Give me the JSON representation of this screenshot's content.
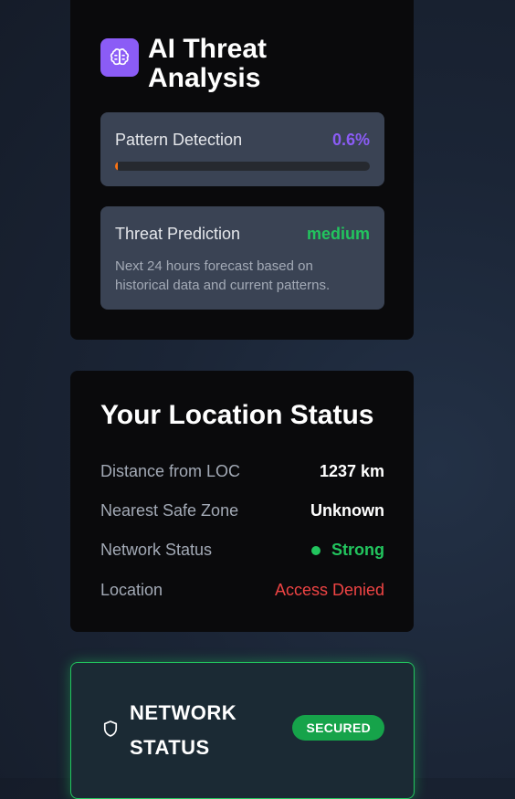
{
  "ai_threat": {
    "title": "AI Threat Analysis",
    "icon": "brain-icon",
    "accent_color": "#8b5cf6",
    "pattern_detection": {
      "label": "Pattern Detection",
      "value": "0.6%",
      "progress_fraction": 0.006
    },
    "threat_prediction": {
      "label": "Threat Prediction",
      "value": "medium",
      "description": "Next 24 hours forecast based on historical data and current patterns."
    }
  },
  "location_status": {
    "title": "Your Location Status",
    "rows": [
      {
        "label": "Distance from LOC",
        "value": "1237 km"
      },
      {
        "label": "Nearest Safe Zone",
        "value": "Unknown"
      },
      {
        "label": "Network Status",
        "value": "Strong",
        "status_color": "#22c55e"
      },
      {
        "label": "Location",
        "value": "Access Denied",
        "status_color": "#ef4444"
      }
    ]
  },
  "network_status": {
    "title": "NETWORK STATUS",
    "icon": "shield-icon",
    "badge": "SECURED",
    "badge_color": "#16a34a"
  }
}
